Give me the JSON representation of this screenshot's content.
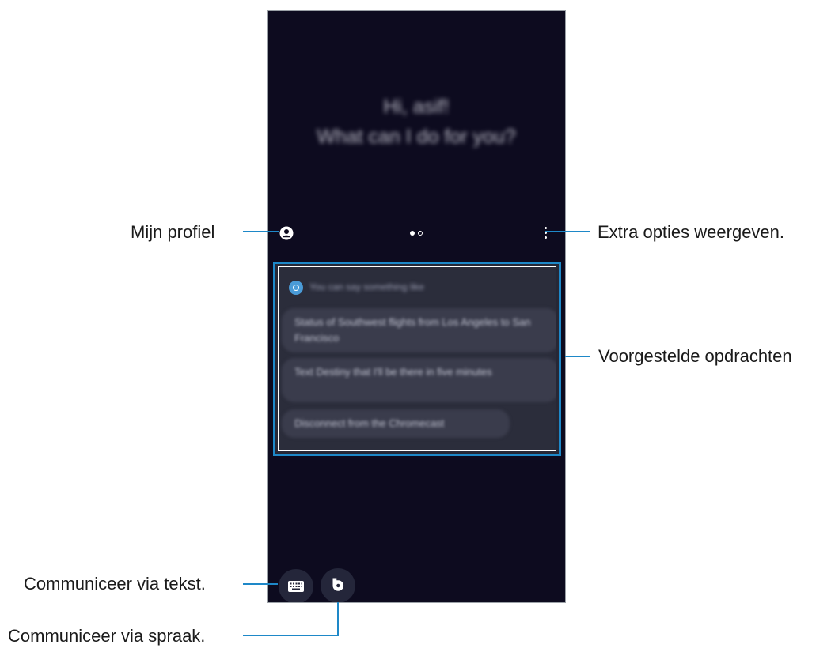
{
  "screen": {
    "greeting_line1": "Hi, asif!",
    "greeting_line2": "What can I do for you?",
    "suggestions_header": "You can say something like",
    "suggestions": [
      "Status of Southwest flights from Los Angeles to San Francisco",
      "Text Destiny that I'll be there in five minutes",
      "Disconnect from the Chromecast"
    ]
  },
  "callouts": {
    "profile": "Mijn profiel",
    "more_options": "Extra opties weergeven.",
    "suggested": "Voorgestelde opdrachten",
    "text_input": "Communiceer via tekst.",
    "voice_input": "Communiceer via spraak."
  },
  "icons": {
    "profile": "profile-icon",
    "more": "more-options-icon",
    "keyboard": "keyboard-icon",
    "bixby": "bixby-icon"
  },
  "colors": {
    "screen_bg": "#0d0b1f",
    "callout_line": "#1e88c8",
    "highlight_border": "#1e88c8"
  }
}
